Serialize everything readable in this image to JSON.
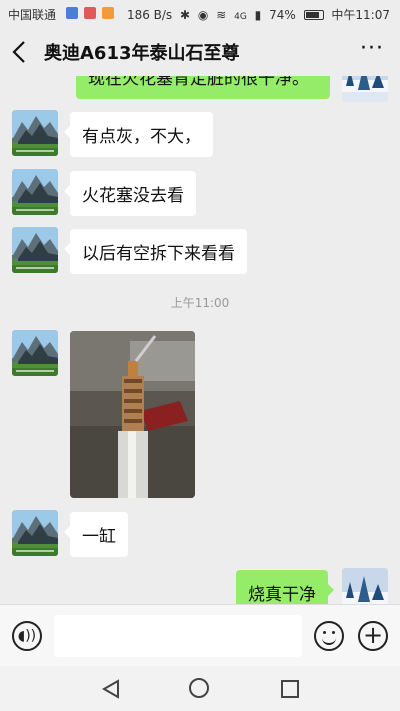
{
  "status_bar": {
    "carrier": "中国联通",
    "net_speed": "186 B/s",
    "signal": "4G",
    "battery": "74%",
    "time": "中午11:07"
  },
  "header": {
    "title": "奥迪A613年泰山石至尊",
    "back_icon": "chevron-left-icon",
    "more_icon": "more-dots-icon",
    "more_label": "···"
  },
  "messages": [
    {
      "side": "me",
      "type": "text",
      "text": "现在火花塞肯定脏的很干净。"
    },
    {
      "side": "other",
      "type": "text",
      "text": "有点灰，不大，"
    },
    {
      "side": "other",
      "type": "text",
      "text": "火花塞没去看"
    },
    {
      "side": "other",
      "type": "text",
      "text": "以后有空拆下来看看"
    },
    {
      "type": "time",
      "text": "上午11:00"
    },
    {
      "side": "other",
      "type": "image",
      "alt": "spark plug photo"
    },
    {
      "side": "other",
      "type": "text",
      "text": "一缸"
    },
    {
      "side": "me",
      "type": "text",
      "text": "烧真干净"
    }
  ],
  "input_bar": {
    "voice_icon": "voice-icon",
    "emoji_icon": "emoji-icon",
    "plus_icon": "plus-icon"
  },
  "nav_bar": {
    "back": "nav-back-icon",
    "home": "nav-home-icon",
    "recent": "nav-recent-icon"
  }
}
